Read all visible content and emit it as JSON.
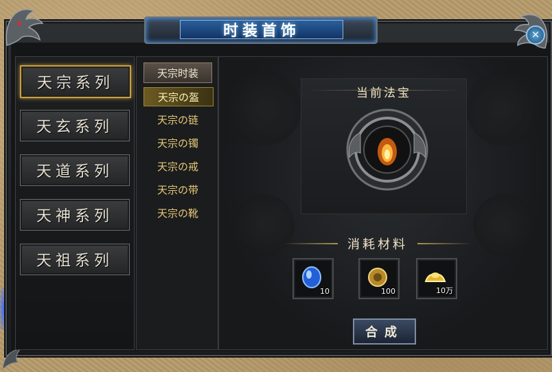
{
  "window": {
    "title": "时装首饰",
    "close_label": "×",
    "colors": {
      "frame": "#2d3033",
      "accent_gold": "#c4a04b",
      "accent_blue": "#2b5f9a",
      "text_gold": "#e6c97a"
    }
  },
  "series_list": [
    {
      "label": "天宗系列",
      "selected": true
    },
    {
      "label": "天玄系列",
      "selected": false
    },
    {
      "label": "天道系列",
      "selected": false
    },
    {
      "label": "天神系列",
      "selected": false
    },
    {
      "label": "天祖系列",
      "selected": false
    }
  ],
  "category": {
    "header": "天宗时装",
    "items": [
      {
        "label": "天宗の盔",
        "selected": true
      },
      {
        "label": "天宗の链",
        "selected": false
      },
      {
        "label": "天宗の镯",
        "selected": false
      },
      {
        "label": "天宗の戒",
        "selected": false
      },
      {
        "label": "天宗の带",
        "selected": false
      },
      {
        "label": "天宗の靴",
        "selected": false
      }
    ]
  },
  "treasure": {
    "title": "当前法宝",
    "icon": "flame-gem-icon"
  },
  "materials": {
    "title": "消耗材料",
    "items": [
      {
        "icon": "blue-crystal-icon",
        "count": "10"
      },
      {
        "icon": "gold-coin-icon",
        "count": "100"
      },
      {
        "icon": "gold-ingot-icon",
        "count": "10万"
      }
    ]
  },
  "actions": {
    "craft_label": "合成"
  }
}
